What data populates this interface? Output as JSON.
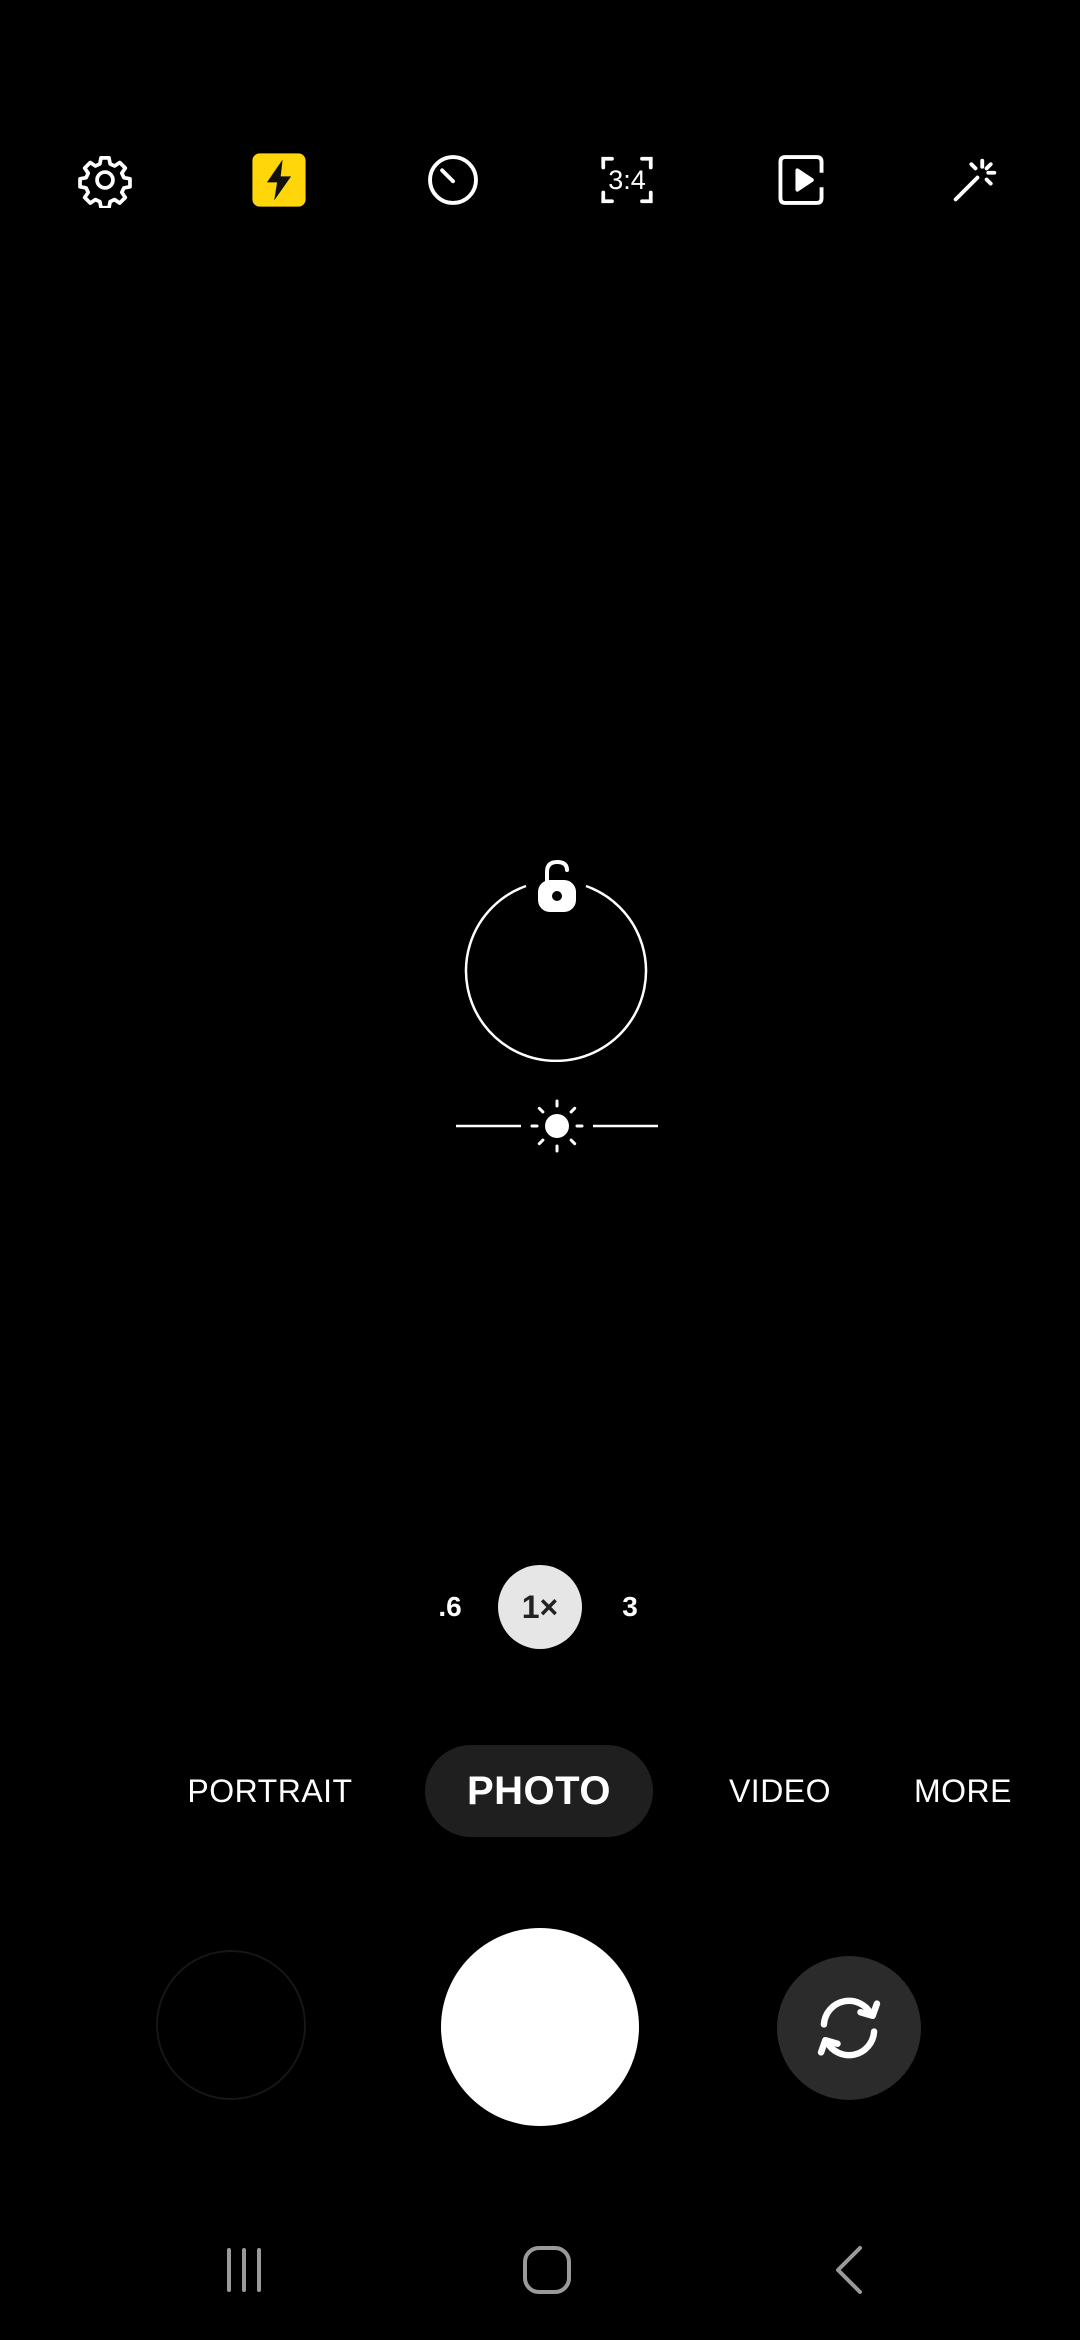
{
  "toolbar": {
    "items": [
      {
        "icon": "gear-icon",
        "name": "settings"
      },
      {
        "icon": "flash-icon",
        "name": "flash",
        "active_color": "#FFD60A"
      },
      {
        "icon": "timer-icon",
        "name": "timer"
      },
      {
        "icon": "aspect-ratio-icon",
        "name": "ratio",
        "label": "3:4"
      },
      {
        "icon": "motion-photo-icon",
        "name": "motion-photo"
      },
      {
        "icon": "magic-wand-icon",
        "name": "effects"
      }
    ]
  },
  "focus": {
    "lock_icon": "unlock-icon",
    "exposure_icon": "sun-icon"
  },
  "zoom": {
    "options": [
      ".6",
      "1×",
      "3"
    ],
    "active_index": 1
  },
  "modes": {
    "items": [
      "PORTRAIT",
      "PHOTO",
      "VIDEO",
      "MORE"
    ],
    "active": "PHOTO"
  },
  "controls": {
    "gallery_icon": "gallery-thumbnail",
    "shutter_icon": "shutter-button",
    "switch_icon": "switch-camera-icon"
  },
  "navbar": {
    "items": [
      "recent-apps-icon",
      "home-icon",
      "back-icon"
    ]
  },
  "colors": {
    "background": "#000000",
    "accent": "#FFD60A",
    "mode_pill": "#1F1F1F",
    "zoom_active": "#E6E6E6"
  }
}
